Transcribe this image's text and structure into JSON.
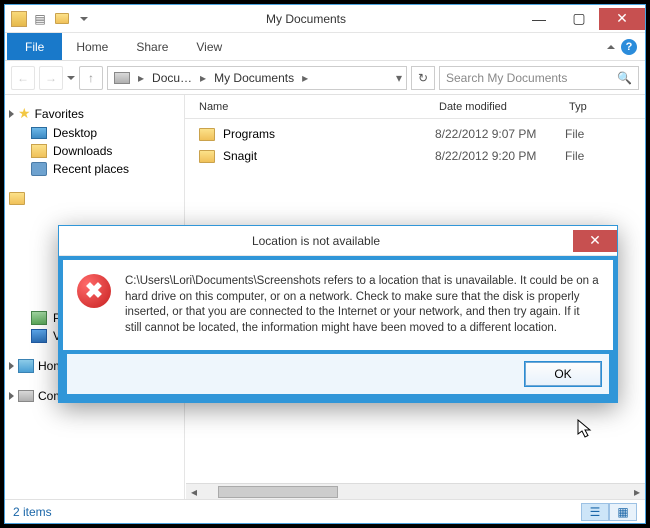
{
  "titlebar": {
    "title": "My Documents"
  },
  "ribbon": {
    "file": "File",
    "tabs": [
      "Home",
      "Share",
      "View"
    ]
  },
  "breadcrumb": {
    "segs": [
      "Docu…",
      "My Documents"
    ]
  },
  "search": {
    "placeholder": "Search My Documents"
  },
  "columns": {
    "name": "Name",
    "date": "Date modified",
    "type": "Typ"
  },
  "navpane": {
    "favorites": {
      "label": "Favorites",
      "items": [
        "Desktop",
        "Downloads",
        "Recent places"
      ]
    },
    "libraries": {
      "pictures": "Pictures",
      "videos": "Videos"
    },
    "homegroup": "Homegroup",
    "computer": "Computer"
  },
  "files": [
    {
      "name": "Programs",
      "date": "8/22/2012 9:07 PM",
      "type": "File"
    },
    {
      "name": "Snagit",
      "date": "8/22/2012 9:20 PM",
      "type": "File"
    }
  ],
  "status": {
    "count": "2 items"
  },
  "dialog": {
    "title": "Location is not available",
    "message": "C:\\Users\\Lori\\Documents\\Screenshots refers to a location that is unavailable. It could be on a hard drive on this computer, or on a network. Check to make sure that the disk is properly inserted, or that you are connected to the Internet or your network, and then try again. If it still cannot be located, the information might have been moved to a different location.",
    "ok": "OK"
  }
}
